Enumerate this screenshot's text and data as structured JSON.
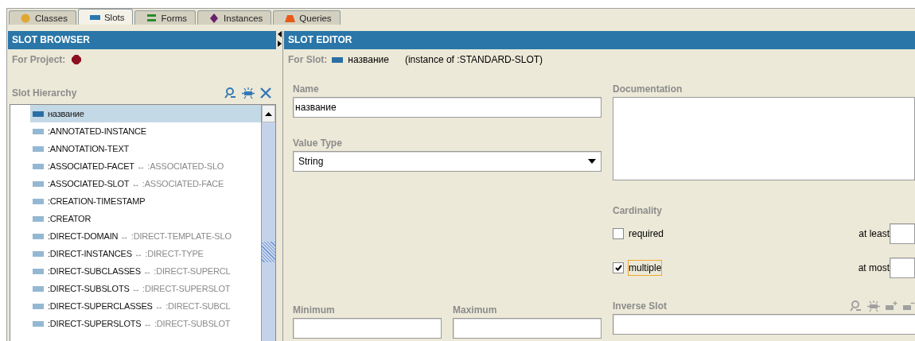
{
  "tabs": [
    {
      "label": "Classes",
      "kind": "classes",
      "selected": false
    },
    {
      "label": "Slots",
      "kind": "slots",
      "selected": true
    },
    {
      "label": "Forms",
      "kind": "forms",
      "selected": false
    },
    {
      "label": "Instances",
      "kind": "instances",
      "selected": false
    },
    {
      "label": "Queries",
      "kind": "queries",
      "selected": false
    }
  ],
  "slot_browser": {
    "title": "SLOT BROWSER",
    "project_label": "For Project:",
    "hierarchy_label": "Slot Hierarchy",
    "items": [
      {
        "name": "название",
        "selected": true
      },
      {
        "name": ":ANNOTATED-INSTANCE",
        "selected": false
      },
      {
        "name": ":ANNOTATION-TEXT",
        "selected": false
      },
      {
        "name": ":ASSOCIATED-FACET",
        "inverse": "↔ :ASSOCIATED-SLO",
        "selected": false
      },
      {
        "name": ":ASSOCIATED-SLOT",
        "inverse": "↔ :ASSOCIATED-FACE",
        "selected": false
      },
      {
        "name": ":CREATION-TIMESTAMP",
        "selected": false
      },
      {
        "name": ":CREATOR",
        "selected": false
      },
      {
        "name": ":DIRECT-DOMAIN",
        "inverse": "↔ :DIRECT-TEMPLATE-SLO",
        "selected": false
      },
      {
        "name": ":DIRECT-INSTANCES",
        "inverse": "↔ :DIRECT-TYPE",
        "selected": false
      },
      {
        "name": ":DIRECT-SUBCLASSES",
        "inverse": "↔ :DIRECT-SUPERCL",
        "selected": false
      },
      {
        "name": ":DIRECT-SUBSLOTS",
        "inverse": "↔ :DIRECT-SUPERSLOT",
        "selected": false
      },
      {
        "name": ":DIRECT-SUPERCLASSES",
        "inverse": "↔ :DIRECT-SUBCL",
        "selected": false
      },
      {
        "name": ":DIRECT-SUPERSLOTS",
        "inverse": "↔ :DIRECT-SUBSLOT",
        "selected": false
      }
    ]
  },
  "slot_editor": {
    "title": "SLOT EDITOR",
    "for_label": "For Slot:",
    "slot_name": "название",
    "instance_of": "(instance of :STANDARD-SLOT)",
    "name_label": "Name",
    "name_value": "название",
    "value_type_label": "Value Type",
    "value_type": "String",
    "documentation_label": "Documentation",
    "cardinality_label": "Cardinality",
    "required": {
      "label": "required",
      "checked": false,
      "focused": false
    },
    "multiple": {
      "label": "multiple",
      "checked": true,
      "focused": true
    },
    "at_least_label": "at least",
    "at_most_label": "at most",
    "minimum_label": "Minimum",
    "maximum_label": "Maximum",
    "inverse_slot_label": "Inverse Slot"
  }
}
